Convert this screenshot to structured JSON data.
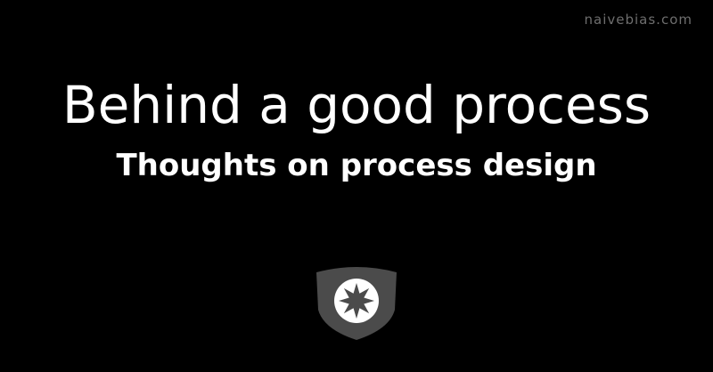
{
  "site": {
    "label": "naivebias.com"
  },
  "post": {
    "title": "Behind a good process",
    "subtitle": "Thoughts on process design"
  },
  "logo": {
    "icon": "shield-star-icon",
    "shield_color": "#4b4b4b",
    "star_color": "#ffffff"
  }
}
